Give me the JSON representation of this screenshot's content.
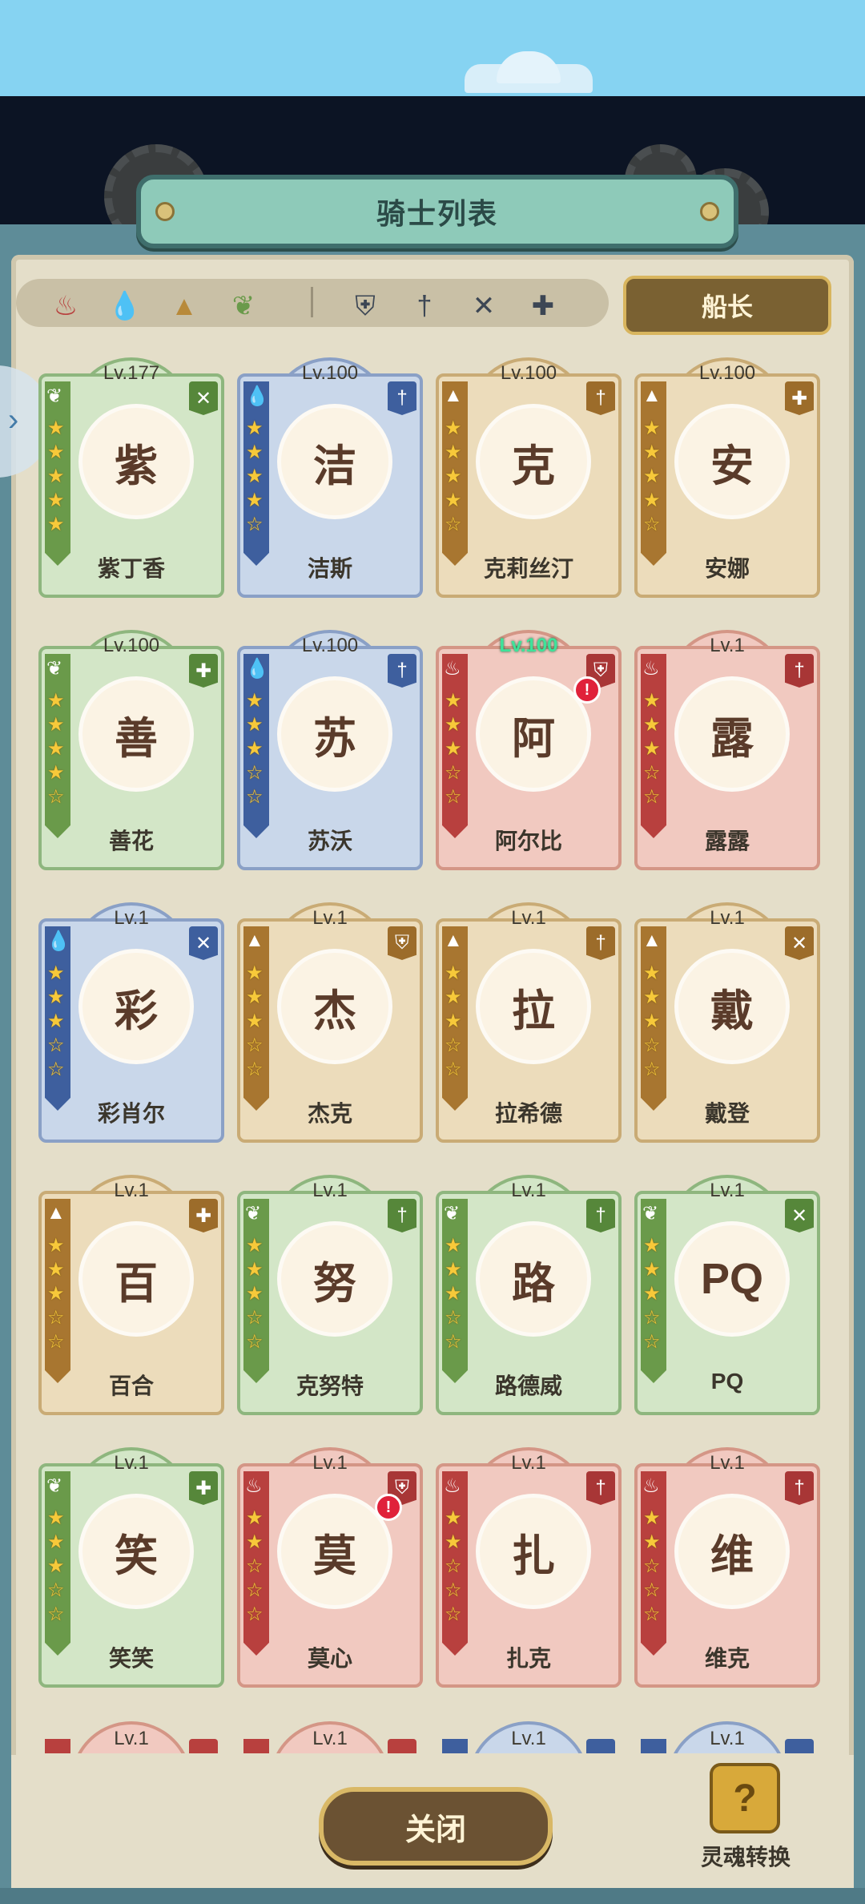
{
  "header": {
    "title": "骑士列表"
  },
  "filters": {
    "elements": [
      {
        "icon": "fire-icon",
        "glyph": "♨",
        "color": "#b8403e"
      },
      {
        "icon": "water-icon",
        "glyph": "💧",
        "color": "#3e6fb8"
      },
      {
        "icon": "earth-icon",
        "glyph": "▲",
        "color": "#b88a3a"
      },
      {
        "icon": "wind-icon",
        "glyph": "❦",
        "color": "#6a9a4a"
      }
    ],
    "roles": [
      {
        "icon": "shield-icon",
        "glyph": "⛨"
      },
      {
        "icon": "sword-icon",
        "glyph": "†"
      },
      {
        "icon": "bow-icon",
        "glyph": "✕"
      },
      {
        "icon": "heal-icon",
        "glyph": "✚"
      }
    ],
    "captain_label": "船长"
  },
  "knights": [
    {
      "name": "紫丁香",
      "level": "Lv.177",
      "element": "g",
      "role_glyph": "✕",
      "stars": 5,
      "alert": false,
      "initial": "紫"
    },
    {
      "name": "洁斯",
      "level": "Lv.100",
      "element": "b",
      "role_glyph": "†",
      "stars": 4,
      "alert": false,
      "initial": "洁"
    },
    {
      "name": "克莉丝汀",
      "level": "Lv.100",
      "element": "o",
      "role_glyph": "†",
      "stars": 4,
      "alert": false,
      "initial": "克"
    },
    {
      "name": "安娜",
      "level": "Lv.100",
      "element": "o",
      "role_glyph": "✚",
      "stars": 4,
      "alert": false,
      "initial": "安"
    },
    {
      "name": "善花",
      "level": "Lv.100",
      "element": "g",
      "role_glyph": "✚",
      "stars": 4,
      "alert": false,
      "initial": "善"
    },
    {
      "name": "苏沃",
      "level": "Lv.100",
      "element": "b",
      "role_glyph": "†",
      "stars": 3,
      "alert": false,
      "initial": "苏"
    },
    {
      "name": "阿尔比",
      "level": "Lv.100",
      "element": "r",
      "role_glyph": "⛨",
      "stars": 3,
      "alert": true,
      "alert_text": "!",
      "initial": "阿",
      "highlight": true
    },
    {
      "name": "露露",
      "level": "Lv.1",
      "element": "r",
      "role_glyph": "†",
      "stars": 3,
      "alert": false,
      "initial": "露"
    },
    {
      "name": "彩肖尔",
      "level": "Lv.1",
      "element": "b",
      "role_glyph": "✕",
      "stars": 3,
      "alert": false,
      "initial": "彩"
    },
    {
      "name": "杰克",
      "level": "Lv.1",
      "element": "o",
      "role_glyph": "⛨",
      "stars": 3,
      "alert": false,
      "initial": "杰"
    },
    {
      "name": "拉希德",
      "level": "Lv.1",
      "element": "o",
      "role_glyph": "†",
      "stars": 3,
      "alert": false,
      "initial": "拉"
    },
    {
      "name": "戴登",
      "level": "Lv.1",
      "element": "o",
      "role_glyph": "✕",
      "stars": 3,
      "alert": false,
      "initial": "戴"
    },
    {
      "name": "百合",
      "level": "Lv.1",
      "element": "o",
      "role_glyph": "✚",
      "stars": 3,
      "alert": false,
      "initial": "百"
    },
    {
      "name": "克努特",
      "level": "Lv.1",
      "element": "g",
      "role_glyph": "†",
      "stars": 3,
      "alert": false,
      "initial": "努"
    },
    {
      "name": "路德威",
      "level": "Lv.1",
      "element": "g",
      "role_glyph": "†",
      "stars": 3,
      "alert": false,
      "initial": "路"
    },
    {
      "name": "PQ",
      "level": "Lv.1",
      "element": "g",
      "role_glyph": "✕",
      "stars": 3,
      "alert": false,
      "initial": "PQ"
    },
    {
      "name": "笑笑",
      "level": "Lv.1",
      "element": "g",
      "role_glyph": "✚",
      "stars": 3,
      "alert": false,
      "initial": "笑"
    },
    {
      "name": "莫心",
      "level": "Lv.1",
      "element": "r",
      "role_glyph": "⛨",
      "stars": 2,
      "alert": true,
      "alert_text": "!",
      "initial": "莫"
    },
    {
      "name": "扎克",
      "level": "Lv.1",
      "element": "r",
      "role_glyph": "†",
      "stars": 2,
      "alert": false,
      "initial": "扎"
    },
    {
      "name": "维克",
      "level": "Lv.1",
      "element": "r",
      "role_glyph": "†",
      "stars": 2,
      "alert": false,
      "initial": "维"
    }
  ],
  "partial_row": [
    {
      "level": "Lv.1",
      "element": "r"
    },
    {
      "level": "Lv.1",
      "element": "r"
    },
    {
      "level": "Lv.1",
      "element": "b"
    },
    {
      "level": "Lv.1",
      "element": "b"
    }
  ],
  "footer": {
    "close_label": "关闭",
    "soul_label": "灵魂转换",
    "soul_glyph": "?"
  },
  "side_tab": {
    "glyph": "›"
  }
}
